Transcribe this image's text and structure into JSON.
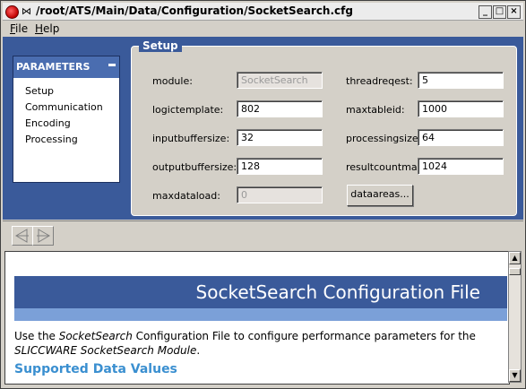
{
  "window": {
    "title": "/root/ATS/Main/Data/Configuration/SocketSearch.cfg",
    "controls": [
      "_",
      "□",
      "×"
    ]
  },
  "menu": {
    "file": "File",
    "help": "Help"
  },
  "sidebar": {
    "header": "PARAMETERS",
    "items": [
      {
        "label": "Setup"
      },
      {
        "label": "Communication"
      },
      {
        "label": "Encoding"
      },
      {
        "label": "Processing"
      }
    ]
  },
  "setup": {
    "legend": "Setup",
    "fields": {
      "module": {
        "label": "module:",
        "value": "SocketSearch"
      },
      "threadreqest": {
        "label": "threadreqest:",
        "value": "5"
      },
      "logictemplate": {
        "label": "logictemplate:",
        "value": "802"
      },
      "maxtableid": {
        "label": "maxtableid:",
        "value": "1000"
      },
      "inputbuffersize": {
        "label": "inputbuffersize:",
        "value": "32"
      },
      "processingsize": {
        "label": "processingsize:",
        "value": "64"
      },
      "outputbuffersize": {
        "label": "outputbuffersize:",
        "value": "128"
      },
      "resultcountmax": {
        "label": "resultcountmax:",
        "value": "1024"
      },
      "maxdataload": {
        "label": "maxdataload:",
        "value": "0"
      }
    },
    "dataareas_button": "dataareas..."
  },
  "doc": {
    "title": "SocketSearch Configuration File",
    "intro_1": "Use the ",
    "intro_em1": "SocketSearch",
    "intro_2": " Configuration File to configure performance parameters for the ",
    "intro_em2": "SLICCWARE SocketSearch Module",
    "intro_3": ".",
    "section_heading": "Supported Data Values"
  },
  "colors": {
    "panel_blue": "#3a5a9a",
    "header_blue": "#4a6db0",
    "banner_strip": "#7ba0d8",
    "heading_blue": "#3a8fd0"
  }
}
